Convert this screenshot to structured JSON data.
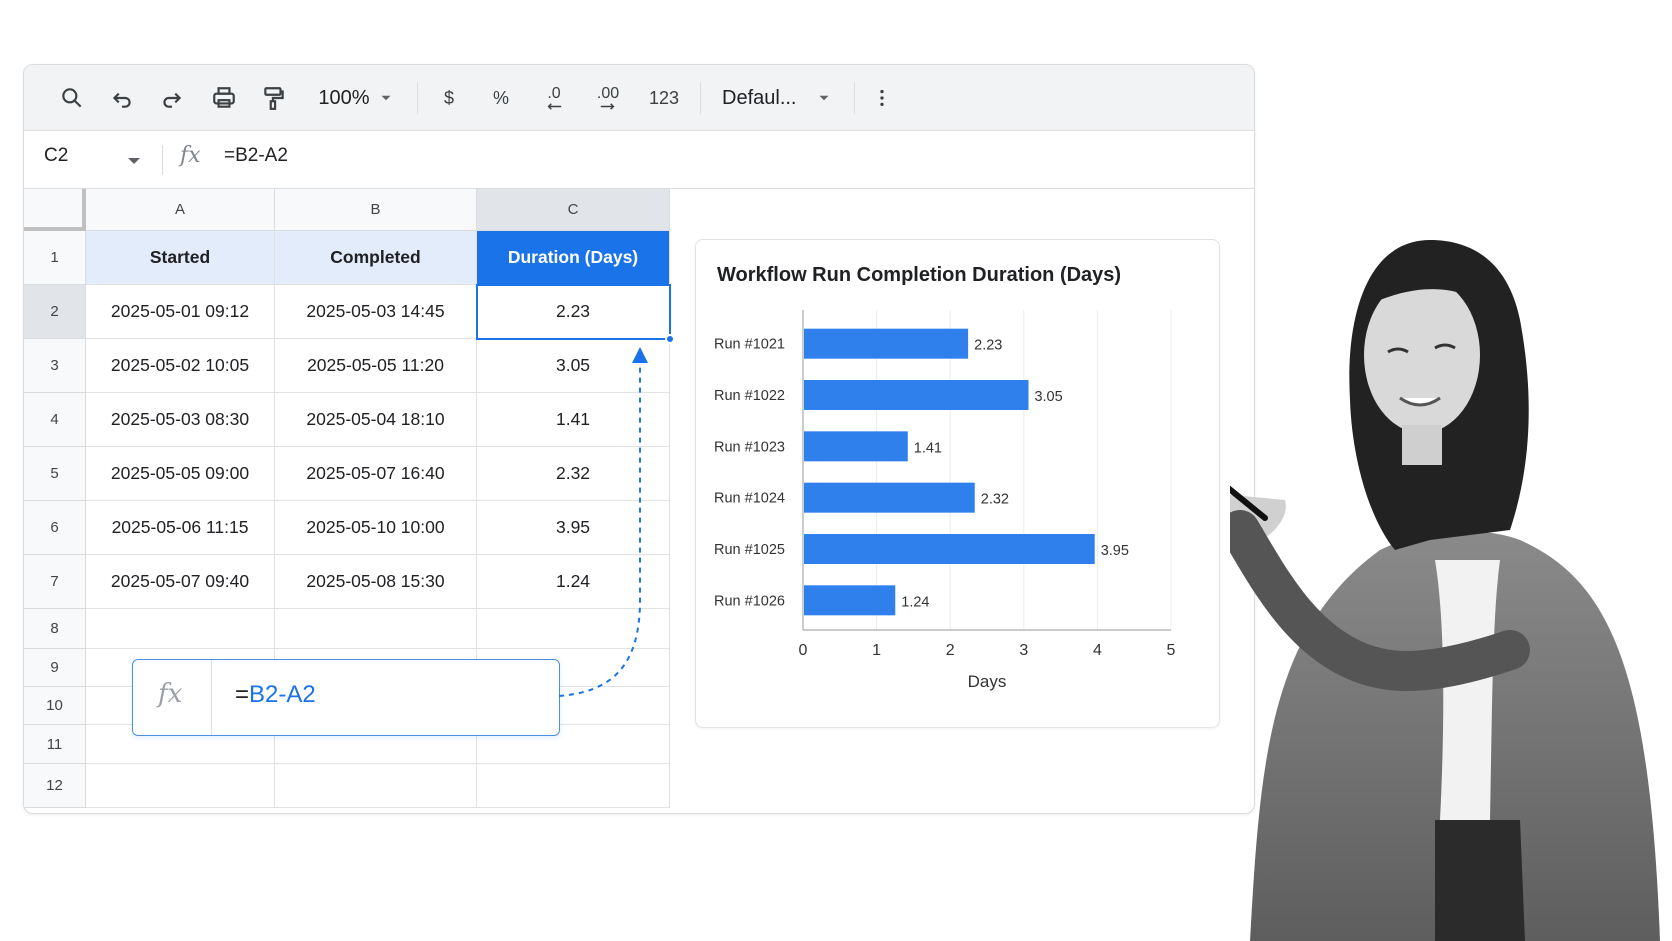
{
  "toolbar": {
    "zoom": "100%",
    "currency": "$",
    "percent": "%",
    "decrease_decimal": ".0",
    "increase_decimal": ".00",
    "number_format": "123",
    "font": "Defaul...",
    "icons": [
      "search-icon",
      "undo-icon",
      "redo-icon",
      "print-icon",
      "paint-format-icon",
      "chevron-down-icon",
      "more-vert-icon"
    ]
  },
  "formula_bar": {
    "cell_ref": "C2",
    "fx": "fx",
    "formula": "=B2-A2"
  },
  "grid": {
    "columns": [
      "A",
      "B",
      "C"
    ],
    "rows": [
      "1",
      "2",
      "3",
      "4",
      "5",
      "6",
      "7",
      "8",
      "9",
      "10",
      "11",
      "12"
    ],
    "headers": [
      "Started",
      "Completed",
      "Duration (Days)"
    ],
    "data": [
      [
        "2025-05-01 09:12",
        "2025-05-03 14:45",
        "2.23"
      ],
      [
        "2025-05-02 10:05",
        "2025-05-05 11:20",
        "3.05"
      ],
      [
        "2025-05-03 08:30",
        "2025-05-04 18:10",
        "1.41"
      ],
      [
        "2025-05-05 09:00",
        "2025-05-07 16:40",
        "2.32"
      ],
      [
        "2025-05-06 11:15",
        "2025-05-10 10:00",
        "3.95"
      ],
      [
        "2025-05-07 09:40",
        "2025-05-08 15:30",
        "1.24"
      ]
    ]
  },
  "callout": {
    "fx": "fx",
    "eq": "=",
    "formula": "B2-A2"
  },
  "chart_data": {
    "type": "bar",
    "orientation": "horizontal",
    "title": "Workflow Run Completion Duration (Days)",
    "categories": [
      "Run #1021",
      "Run #1022",
      "Run #1023",
      "Run #1024",
      "Run #1025",
      "Run #1026"
    ],
    "values": [
      2.23,
      3.05,
      1.41,
      2.32,
      3.95,
      1.24
    ],
    "data_labels": [
      "2.23",
      "3.05",
      "1.41",
      "2.32",
      "3.95",
      "1.24"
    ],
    "xlabel": "Days",
    "ylabel": "",
    "xlim": [
      0,
      5
    ],
    "xticks": [
      "0",
      "1",
      "2",
      "3",
      "4",
      "5"
    ],
    "grid": true,
    "legend": "none",
    "bar_color": "#2f80ed"
  },
  "colors": {
    "accent": "#1a73e8",
    "header_fill": "#e3ecfb",
    "bar": "#2f80ed"
  }
}
